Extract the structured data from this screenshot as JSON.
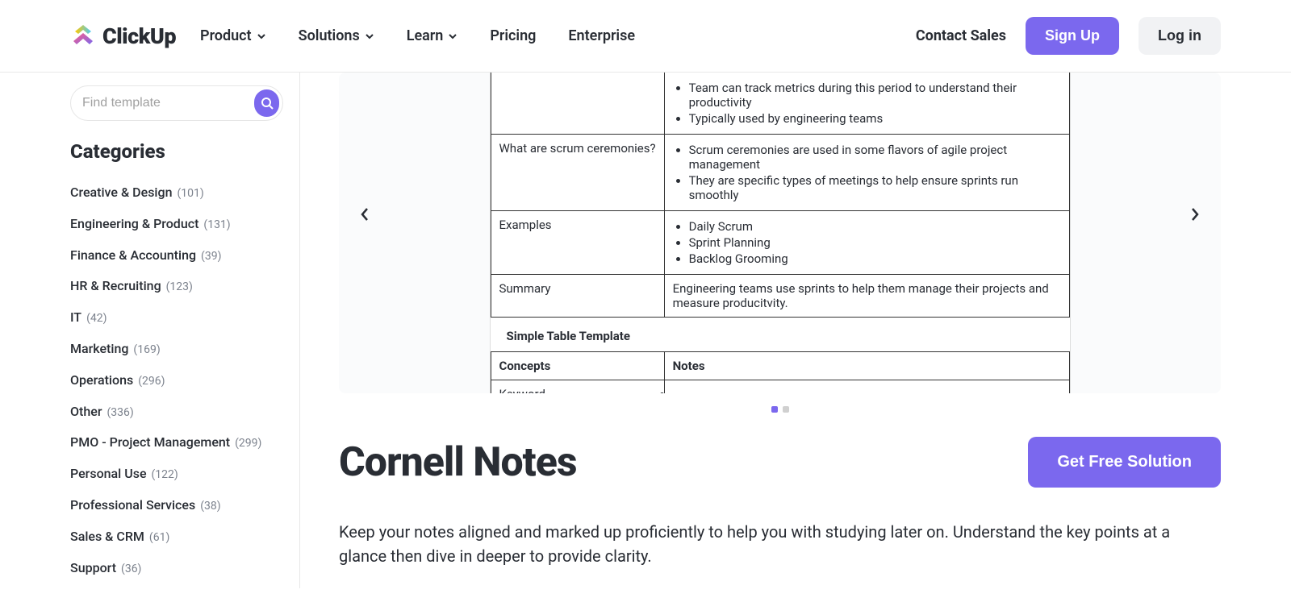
{
  "header": {
    "logo_text": "ClickUp",
    "nav": [
      {
        "label": "Product",
        "has_dropdown": true
      },
      {
        "label": "Solutions",
        "has_dropdown": true
      },
      {
        "label": "Learn",
        "has_dropdown": true
      },
      {
        "label": "Pricing",
        "has_dropdown": false
      },
      {
        "label": "Enterprise",
        "has_dropdown": false
      }
    ],
    "contact_sales": "Contact Sales",
    "signup": "Sign Up",
    "login": "Log in"
  },
  "sidebar": {
    "search_placeholder": "Find template",
    "categories_title": "Categories",
    "categories": [
      {
        "name": "Creative & Design",
        "count": "(101)"
      },
      {
        "name": "Engineering & Product",
        "count": "(131)"
      },
      {
        "name": "Finance & Accounting",
        "count": "(39)"
      },
      {
        "name": "HR & Recruiting",
        "count": "(123)"
      },
      {
        "name": "IT",
        "count": "(42)"
      },
      {
        "name": "Marketing",
        "count": "(169)"
      },
      {
        "name": "Operations",
        "count": "(296)"
      },
      {
        "name": "Other",
        "count": "(336)"
      },
      {
        "name": "PMO - Project Management",
        "count": "(299)"
      },
      {
        "name": "Personal Use",
        "count": "(122)"
      },
      {
        "name": "Professional Services",
        "count": "(38)"
      },
      {
        "name": "Sales & CRM",
        "count": "(61)"
      },
      {
        "name": "Support",
        "count": "(36)"
      }
    ]
  },
  "preview": {
    "rows": [
      {
        "concept": "",
        "bullets": [
          "Team can track metrics during this period to understand their productivity",
          "Typically used by engineering teams"
        ]
      },
      {
        "concept": "What are scrum ceremonies?",
        "bullets": [
          "Scrum ceremonies are used in some flavors of agile project management",
          "They are specific types of meetings to help ensure sprints run smoothly"
        ]
      },
      {
        "concept": "Examples",
        "bullets": [
          "Daily Scrum",
          "Sprint Planning",
          "Backlog Grooming"
        ]
      },
      {
        "concept": "Summary",
        "summary": "Engineering teams use sprints to help them manage their projects and measure producitvity."
      }
    ],
    "table2_title": "Simple Table Template",
    "table2_headers": [
      "Concepts",
      "Notes"
    ],
    "table2_row1": [
      "Keyword",
      "..."
    ]
  },
  "main": {
    "title": "Cornell Notes",
    "cta": "Get Free Solution",
    "description": "Keep your notes aligned and marked up proficiently to help you with studying later on. Understand the key points at a glance then dive in deeper to provide clarity."
  }
}
